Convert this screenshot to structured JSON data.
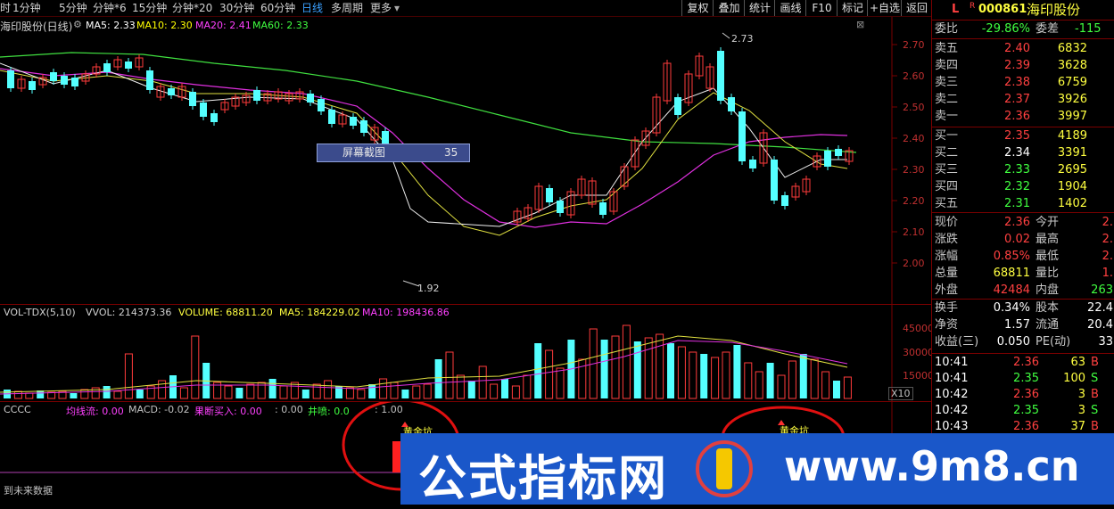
{
  "topbar": {
    "tabs": [
      "时",
      "1分钟",
      "5分钟",
      "分钟*6",
      "15分钟",
      "分钟*20",
      "30分钟",
      "60分钟",
      "日线",
      "多周期",
      "更多"
    ],
    "buttons": [
      "复权",
      "叠加",
      "统计",
      "画线",
      "F10",
      "标记",
      "+自选",
      "返回"
    ]
  },
  "main_chart": {
    "title": "海印股份(日线)",
    "ma_labels": [
      {
        "text": "MA5: 2.33",
        "color": "#ffffff"
      },
      {
        "text": "MA10: 2.30",
        "color": "#ffff00"
      },
      {
        "text": "MA20: 2.41",
        "color": "#ff40ff"
      },
      {
        "text": "MA60: 2.33",
        "color": "#40ff40"
      }
    ],
    "price_axis": [
      "2.70",
      "2.60",
      "2.50",
      "2.40",
      "2.30",
      "2.20",
      "2.10",
      "2.00"
    ],
    "high_label": "2.73",
    "low_label": "1.92",
    "tooltip_label": "屏幕截图",
    "tooltip_value": "35"
  },
  "volume_chart": {
    "title": "VOL-TDX(5,10)",
    "vvol": "VVOL: 214373.36",
    "volume": "VOLUME: 68811.20",
    "ma5": "MA5: 184229.02",
    "ma10": "MA10: 198436.86",
    "axis": [
      "45000",
      "30000",
      "15000"
    ],
    "unit": "X10"
  },
  "indicator_chart": {
    "title": "CCCC",
    "items": [
      {
        "text": "均线流: 0.00",
        "color": "#ff40ff"
      },
      {
        "text": "MACD: -0.02",
        "color": "#c0c0c0"
      },
      {
        "text": "果断买入: 0.00",
        "color": "#ff40ff"
      },
      {
        "text": ": 0.00",
        "color": "#c0c0c0"
      },
      {
        "text": "井喷: 0.0",
        "color": "#40ff40"
      },
      {
        "text": ": 1.00",
        "color": "#c0c0c0"
      }
    ],
    "signal_label_1": "黄金坑",
    "signal_label_2": "黄金坑",
    "footer": "到未来数据"
  },
  "right_panel": {
    "stock_code": "000861",
    "stock_name": "海印股份",
    "webi_label": "委比",
    "webi_value": "-29.86%",
    "weicha_label": "委差",
    "weicha_value": "-115",
    "asks": [
      {
        "label": "卖五",
        "price": "2.40",
        "vol": "6832"
      },
      {
        "label": "卖四",
        "price": "2.39",
        "vol": "3628"
      },
      {
        "label": "卖三",
        "price": "2.38",
        "vol": "6759"
      },
      {
        "label": "卖二",
        "price": "2.37",
        "vol": "3926"
      },
      {
        "label": "卖一",
        "price": "2.36",
        "vol": "3997"
      }
    ],
    "bids": [
      {
        "label": "买一",
        "price": "2.35",
        "vol": "4189"
      },
      {
        "label": "买二",
        "price": "2.34",
        "vol": "3391"
      },
      {
        "label": "买三",
        "price": "2.33",
        "vol": "2695"
      },
      {
        "label": "买四",
        "price": "2.32",
        "vol": "1904"
      },
      {
        "label": "买五",
        "price": "2.31",
        "vol": "1402"
      }
    ],
    "stats": [
      {
        "l1": "现价",
        "v1": "2.36",
        "l2": "今开",
        "v2": "2."
      },
      {
        "l1": "涨跌",
        "v1": "0.02",
        "l2": "最高",
        "v2": "2."
      },
      {
        "l1": "涨幅",
        "v1": "0.85%",
        "l2": "最低",
        "v2": "2."
      },
      {
        "l1": "总量",
        "v1": "68811",
        "l2": "量比",
        "v2": "1."
      },
      {
        "l1": "外盘",
        "v1": "42484",
        "l2": "内盘",
        "v2": "263"
      }
    ],
    "stats2": [
      {
        "l1": "换手",
        "v1": "0.34%",
        "l2": "股本",
        "v2": "22.4"
      },
      {
        "l1": "净资",
        "v1": "1.57",
        "l2": "流通",
        "v2": "20.4"
      },
      {
        "l1": "收益(三)",
        "v1": "0.050",
        "l2": "PE(动)",
        "v2": "33"
      }
    ],
    "ticks": [
      {
        "time": "10:41",
        "price": "2.36",
        "vol": "63",
        "side": "B"
      },
      {
        "time": "10:41",
        "price": "2.35",
        "vol": "100",
        "side": "S"
      },
      {
        "time": "10:42",
        "price": "2.36",
        "vol": "3",
        "side": "B"
      },
      {
        "time": "10:42",
        "price": "2.35",
        "vol": "3",
        "side": "S"
      },
      {
        "time": "10:43",
        "price": "2.36",
        "vol": "37",
        "side": "B"
      }
    ]
  },
  "watermark": {
    "left": "公式指标网",
    "right": "www.9m8.cn"
  }
}
